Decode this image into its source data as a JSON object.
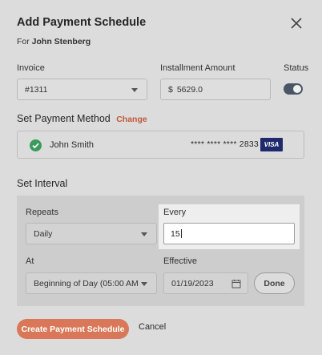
{
  "modal": {
    "title": "Add Payment Schedule",
    "subtitle_prefix": "For",
    "customer_name": "John Stenberg"
  },
  "invoice": {
    "label": "Invoice",
    "value": "#1311"
  },
  "installment": {
    "label": "Installment Amount",
    "currency_symbol": "$",
    "value": "5629.0"
  },
  "status": {
    "label": "Status",
    "enabled": true
  },
  "payment_method": {
    "section_title": "Set Payment Method",
    "change_label": "Change",
    "name": "John Smith",
    "masked_number": "**** **** **** 2833",
    "card_brand": "VISA"
  },
  "interval": {
    "section_title": "Set Interval",
    "repeats": {
      "label": "Repeats",
      "value": "Daily"
    },
    "every": {
      "label": "Every",
      "value": "15"
    },
    "at": {
      "label": "At",
      "value": "Beginning of Day (05:00 AM"
    },
    "effective": {
      "label": "Effective",
      "value": "01/19/2023"
    },
    "done_label": "Done"
  },
  "actions": {
    "create_label": "Create Payment Schedule",
    "cancel_label": "Cancel"
  },
  "colors": {
    "accent": "#d97858",
    "link": "#c0583a",
    "success": "#3b9a5c",
    "toggle_on": "#4a5566",
    "visa": "#1e2a6b"
  }
}
